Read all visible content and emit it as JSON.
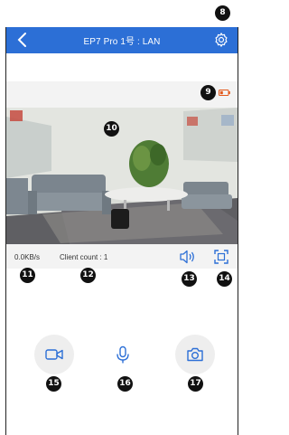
{
  "navbar": {
    "back_icon": "chevron-left-icon",
    "title": "EP7 Pro 1号 : LAN",
    "settings_icon": "gear-icon"
  },
  "video": {
    "battery_icon": "battery-low-icon"
  },
  "info": {
    "speed": "0.0KB/s",
    "client_count": "Client count : 1"
  },
  "controls": {
    "speaker_icon": "speaker-icon",
    "fullscreen_icon": "fullscreen-icon",
    "record_icon": "video-camera-icon",
    "mic_icon": "microphone-icon",
    "snapshot_icon": "camera-icon"
  },
  "annotations": [
    "8",
    "9",
    "10",
    "11",
    "12",
    "13",
    "14",
    "15",
    "16",
    "17"
  ],
  "colors": {
    "accent": "#2c6fd6",
    "battery": "#e25a1c",
    "badge": "#111111"
  }
}
